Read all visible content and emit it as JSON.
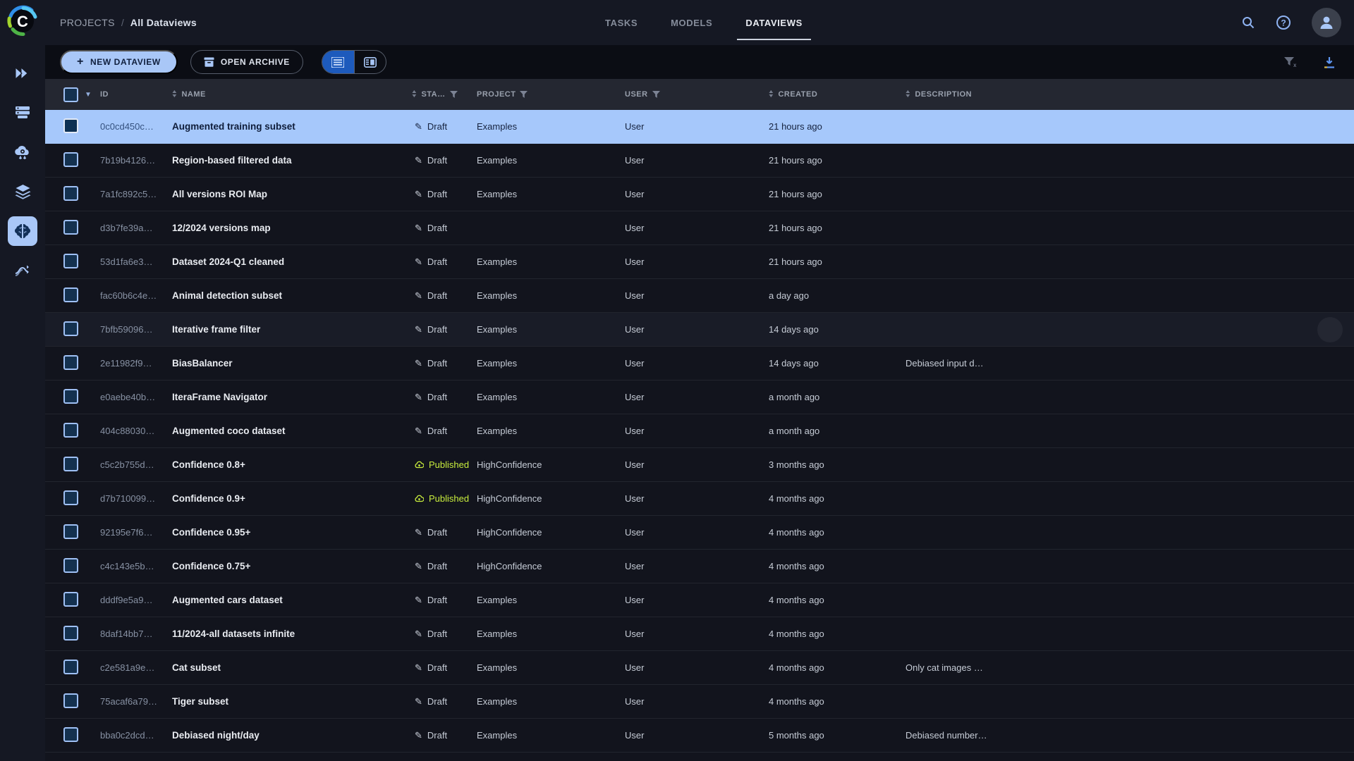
{
  "colors": {
    "topbar_bg": "#151823",
    "toolbar_bg": "#0b0d14",
    "table_header_bg": "#242731",
    "row_bg": "#12141d",
    "selected_row_bg": "#a6c8fb",
    "accent_light_blue": "#a9c7f7",
    "active_toggle_blue": "#1d5abc",
    "published_green": "#c9ee3d",
    "name_text": "#e9ecf1",
    "id_text": "#8791a3",
    "header_text": "#99a0ad"
  },
  "sidebar": {
    "logo": "C",
    "items": [
      {
        "icon": "projects-icon"
      },
      {
        "icon": "workers-queues-icon"
      },
      {
        "icon": "applications-cloud-icon"
      },
      {
        "icon": "datasets-layers-icon"
      },
      {
        "icon": "dataviews-brain-icon",
        "active": true
      },
      {
        "icon": "pipelines-icon"
      }
    ]
  },
  "topbar": {
    "breadcrumb": {
      "root": "PROJECTS",
      "separator": "/",
      "current": "All Dataviews"
    },
    "tabs": [
      {
        "label": "TASKS",
        "active": false
      },
      {
        "label": "MODELS",
        "active": false
      },
      {
        "label": "DATAVIEWS",
        "active": true
      }
    ],
    "icons": [
      "search-icon",
      "help-icon",
      "profile-avatar"
    ]
  },
  "toolbar": {
    "new_dataview_label": "NEW DATAVIEW",
    "open_archive_label": "OPEN ARCHIVE",
    "view_toggle": [
      {
        "icon": "table-view-icon",
        "active": true
      },
      {
        "icon": "split-view-icon",
        "active": false
      }
    ],
    "right_icons": [
      "clear-filters-icon",
      "download-icon"
    ]
  },
  "table": {
    "headers": {
      "id": "ID",
      "name": "NAME",
      "status": "STA…",
      "project": "PROJECT",
      "user": "USER",
      "created": "CREATED",
      "description": "DESCRIPTION"
    },
    "rows": [
      {
        "id": "0c0cd450c…",
        "name": "Augmented training subset",
        "status": "Draft",
        "published": false,
        "project": "Examples",
        "user": "User",
        "created": "21 hours ago",
        "description": "",
        "selected": true,
        "hovered": false
      },
      {
        "id": "7b19b4126…",
        "name": "Region-based filtered data",
        "status": "Draft",
        "published": false,
        "project": "Examples",
        "user": "User",
        "created": "21 hours ago",
        "description": "",
        "selected": false,
        "hovered": false
      },
      {
        "id": "7a1fc892c5…",
        "name": "All versions ROI Map",
        "status": "Draft",
        "published": false,
        "project": "Examples",
        "user": "User",
        "created": "21 hours ago",
        "description": "",
        "selected": false,
        "hovered": false
      },
      {
        "id": "d3b7fe39a…",
        "name": "12/2024 versions map",
        "status": "Draft",
        "published": false,
        "project": "",
        "user": "User",
        "created": "21 hours ago",
        "description": "",
        "selected": false,
        "hovered": false
      },
      {
        "id": "53d1fa6e3…",
        "name": "Dataset 2024-Q1 cleaned",
        "status": "Draft",
        "published": false,
        "project": "Examples",
        "user": "User",
        "created": "21 hours ago",
        "description": "",
        "selected": false,
        "hovered": false
      },
      {
        "id": "fac60b6c4e…",
        "name": "Animal detection subset",
        "status": "Draft",
        "published": false,
        "project": "Examples",
        "user": "User",
        "created": "a day ago",
        "description": "",
        "selected": false,
        "hovered": false
      },
      {
        "id": "7bfb59096…",
        "name": "Iterative frame filter",
        "status": "Draft",
        "published": false,
        "project": "Examples",
        "user": "User",
        "created": "14 days ago",
        "description": "",
        "selected": false,
        "hovered": true
      },
      {
        "id": "2e11982f9…",
        "name": "BiasBalancer",
        "status": "Draft",
        "published": false,
        "project": "Examples",
        "user": "User",
        "created": "14 days ago",
        "description": "Debiased input d…",
        "selected": false,
        "hovered": false
      },
      {
        "id": "e0aebe40b…",
        "name": "IteraFrame Navigator",
        "status": "Draft",
        "published": false,
        "project": "Examples",
        "user": "User",
        "created": "a month ago",
        "description": "",
        "selected": false,
        "hovered": false
      },
      {
        "id": "404c88030…",
        "name": "Augmented coco dataset",
        "status": "Draft",
        "published": false,
        "project": "Examples",
        "user": "User",
        "created": "a month ago",
        "description": "",
        "selected": false,
        "hovered": false
      },
      {
        "id": "c5c2b755d…",
        "name": "Confidence 0.8+",
        "status": "Published",
        "published": true,
        "project": "HighConfidence",
        "user": "User",
        "created": "3 months ago",
        "description": "",
        "selected": false,
        "hovered": false
      },
      {
        "id": "d7b710099…",
        "name": "Confidence 0.9+",
        "status": "Published",
        "published": true,
        "project": "HighConfidence",
        "user": "User",
        "created": "4 months ago",
        "description": "",
        "selected": false,
        "hovered": false
      },
      {
        "id": "92195e7f6…",
        "name": "Confidence 0.95+",
        "status": "Draft",
        "published": false,
        "project": "HighConfidence",
        "user": "User",
        "created": "4 months ago",
        "description": "",
        "selected": false,
        "hovered": false
      },
      {
        "id": "c4c143e5b…",
        "name": "Confidence 0.75+",
        "status": "Draft",
        "published": false,
        "project": "HighConfidence",
        "user": "User",
        "created": "4 months ago",
        "description": "",
        "selected": false,
        "hovered": false
      },
      {
        "id": "dddf9e5a9…",
        "name": "Augmented cars dataset",
        "status": "Draft",
        "published": false,
        "project": "Examples",
        "user": "User",
        "created": "4 months ago",
        "description": "",
        "selected": false,
        "hovered": false
      },
      {
        "id": "8daf14bb7…",
        "name": "11/2024-all datasets infinite",
        "status": "Draft",
        "published": false,
        "project": "Examples",
        "user": "User",
        "created": "4 months ago",
        "description": "",
        "selected": false,
        "hovered": false
      },
      {
        "id": "c2e581a9e…",
        "name": "Cat subset",
        "status": "Draft",
        "published": false,
        "project": "Examples",
        "user": "User",
        "created": "4 months ago",
        "description": "Only cat images …",
        "selected": false,
        "hovered": false
      },
      {
        "id": "75acaf6a79…",
        "name": "Tiger subset",
        "status": "Draft",
        "published": false,
        "project": "Examples",
        "user": "User",
        "created": "4 months ago",
        "description": "",
        "selected": false,
        "hovered": false
      },
      {
        "id": "bba0c2dcd…",
        "name": "Debiased night/day",
        "status": "Draft",
        "published": false,
        "project": "Examples",
        "user": "User",
        "created": "5 months ago",
        "description": "Debiased number…",
        "selected": false,
        "hovered": false
      }
    ]
  }
}
